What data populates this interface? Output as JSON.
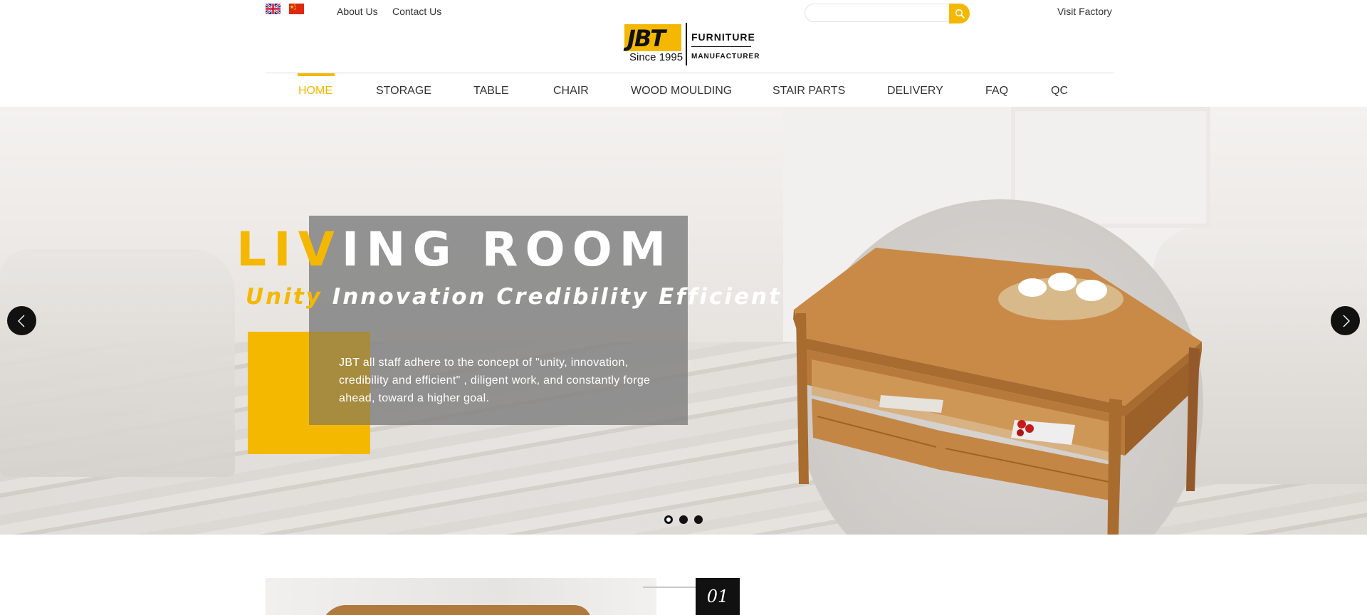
{
  "topbar": {
    "lang_en_icon": "uk-flag-icon",
    "lang_cn_icon": "china-flag-icon",
    "about": "About Us",
    "contact": "Contact Us",
    "search_placeholder": "",
    "search_icon": "search-icon",
    "visit": "Visit Factory"
  },
  "logo": {
    "mark": "JBT",
    "since": "Since 1995",
    "line1": "FURNITURE",
    "line2": "MANUFACTURER"
  },
  "nav": {
    "items": [
      "HOME",
      "STORAGE",
      "TABLE",
      "CHAIR",
      "WOOD MOULDING",
      "STAIR PARTS",
      "DELIVERY",
      "FAQ",
      "QC"
    ],
    "active": "HOME"
  },
  "hero": {
    "title_highlight": "LIV",
    "title_rest": "ING ROOM",
    "subtitle_highlight": "Unity",
    "subtitle_rest": " Innovation Credibility Efficient",
    "description": "JBT all staff adhere to the concept of \"unity, innovation, credibility and efficient\" , diligent work, and constantly forge ahead, toward a higher goal.",
    "prev_icon": "chevron-left-icon",
    "next_icon": "chevron-right-icon",
    "slides": 3,
    "active_slide": 1
  },
  "section": {
    "number": "01"
  },
  "colors": {
    "accent": "#f5b800",
    "dark": "#111111",
    "text": "#333333"
  }
}
